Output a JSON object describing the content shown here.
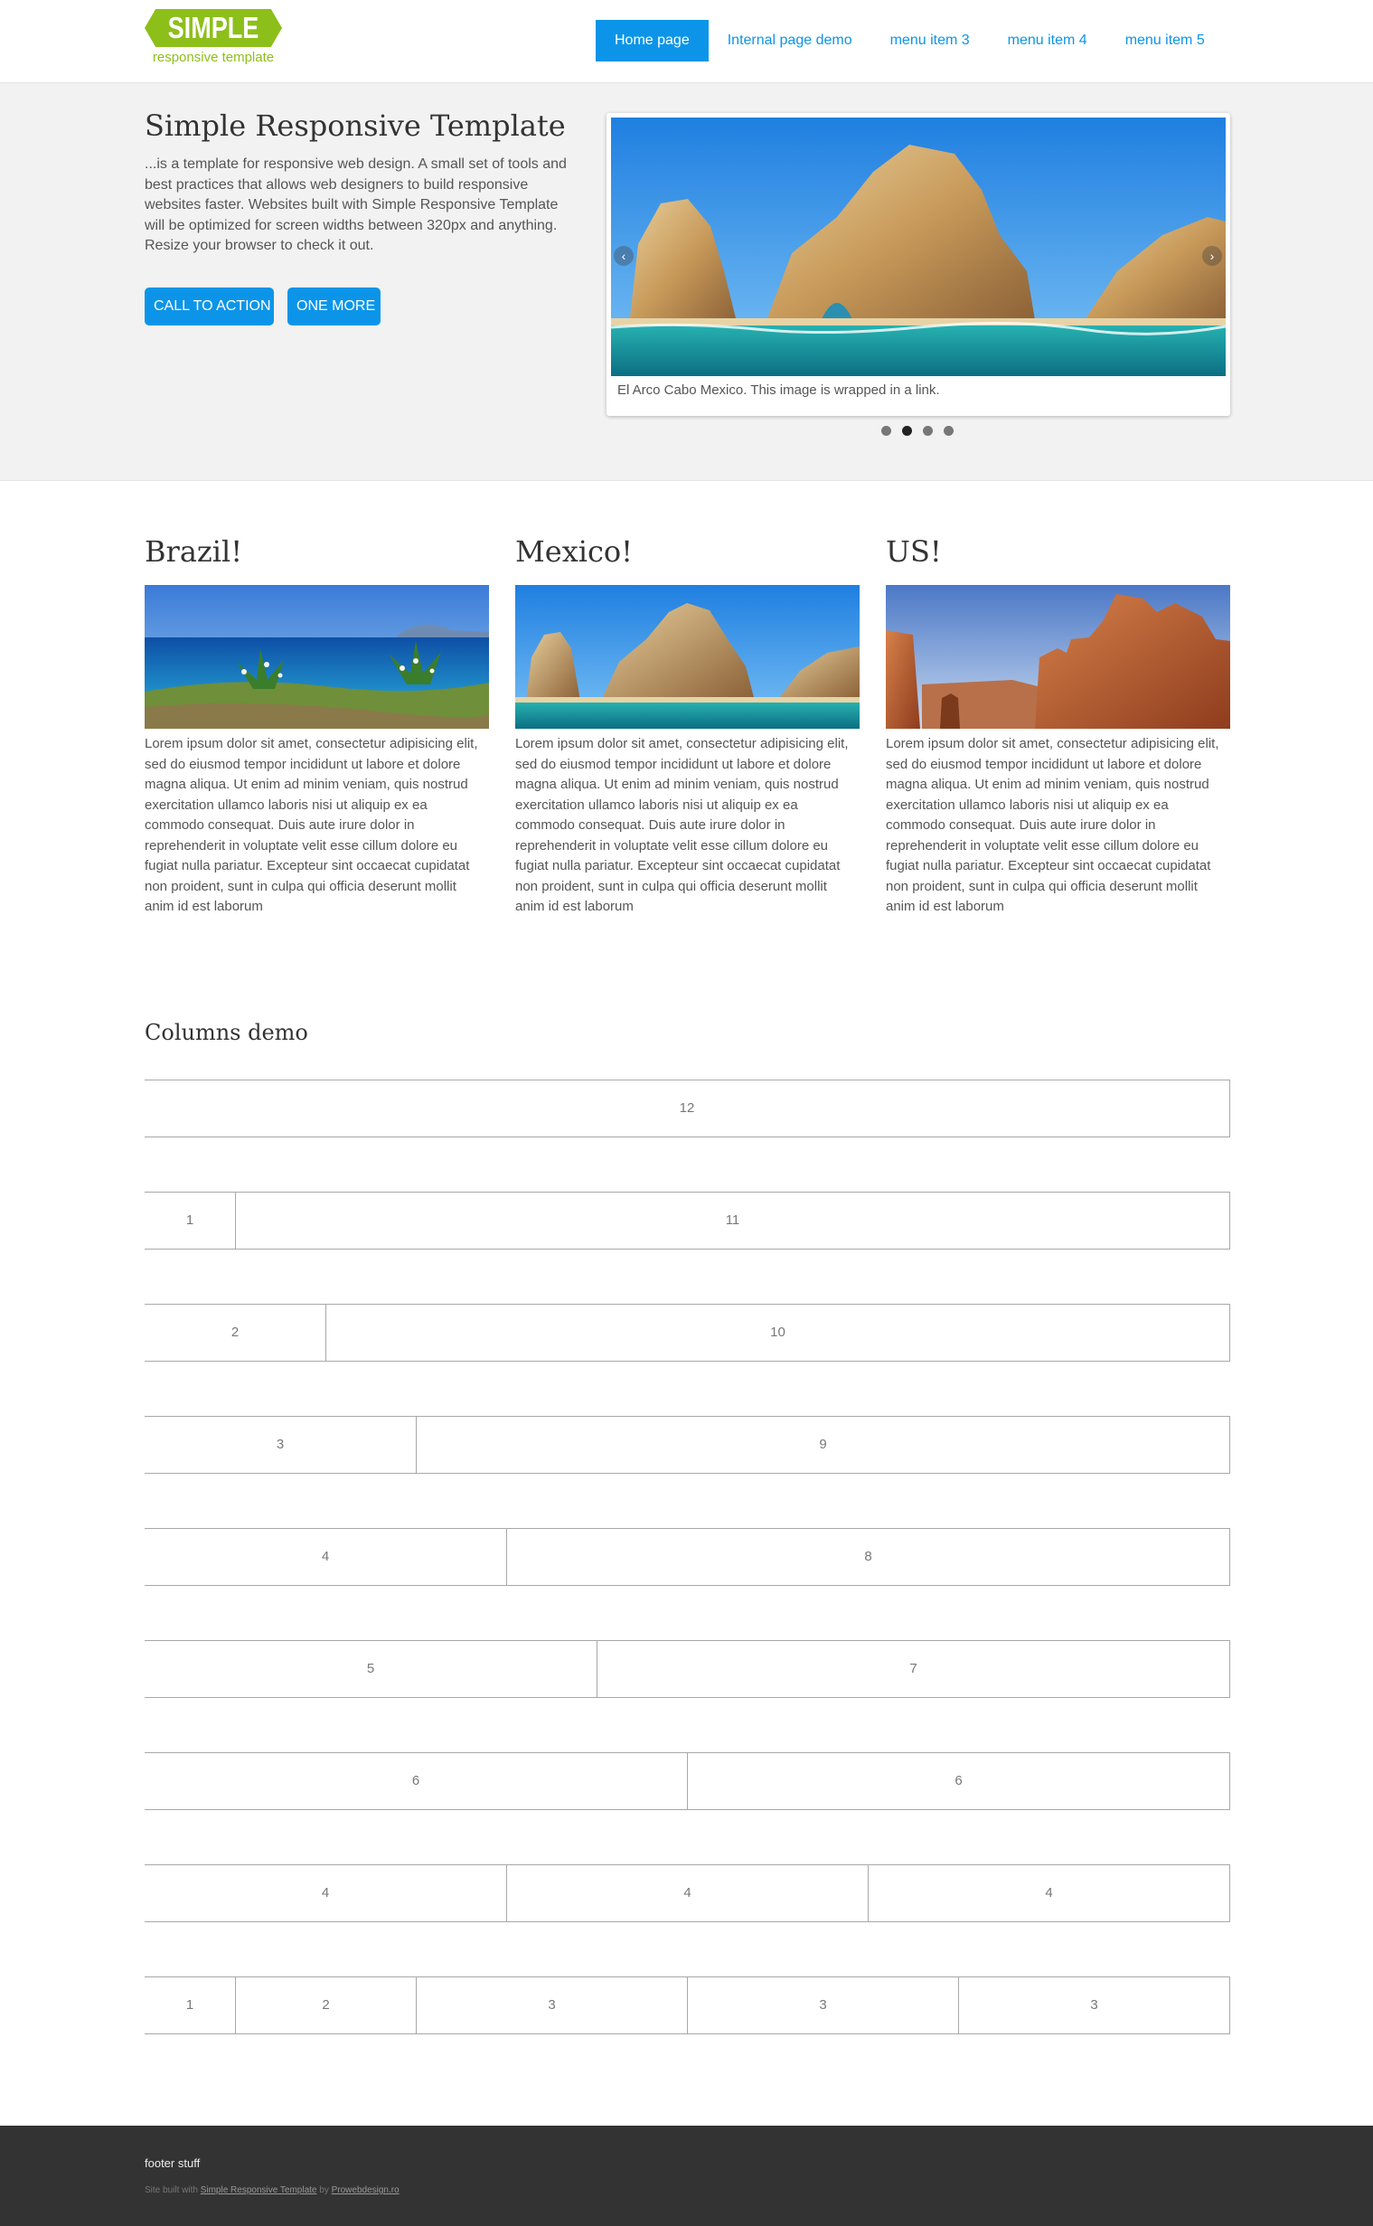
{
  "header": {
    "logo": {
      "word": "SIMPLE",
      "tagline": "responsive template",
      "color": "#8dbf1a"
    },
    "nav": [
      {
        "label": "Home page",
        "active": true
      },
      {
        "label": "Internal page demo",
        "active": false
      },
      {
        "label": "menu item 3",
        "active": false
      },
      {
        "label": "menu item 4",
        "active": false
      },
      {
        "label": "menu item 5",
        "active": false
      }
    ]
  },
  "hero": {
    "title": "Simple Responsive Template",
    "text": "...is a template for responsive web design. A small set of tools and best practices that allows web designers to build responsive websites faster. Websites built with Simple Responsive Template will be optimized for screen widths between 320px and anything. Resize your browser to check it out.",
    "buttons": [
      "CALL TO ACTION",
      "ONE MORE"
    ],
    "slider": {
      "caption": "El Arco Cabo Mexico. This image is wrapped in a link.",
      "prev_icon": "chevron-left-icon",
      "next_icon": "chevron-right-icon",
      "dots": 4,
      "active_dot": 2
    }
  },
  "features": [
    {
      "title": "Brazil!",
      "text": "Lorem ipsum dolor sit amet, consectetur adipisicing elit, sed do eiusmod tempor incididunt ut labore et dolore magna aliqua. Ut enim ad minim veniam, quis nostrud exercitation ullamco laboris nisi ut aliquip ex ea commodo consequat. Duis aute irure dolor in reprehenderit in voluptate velit esse cillum dolore eu fugiat nulla pariatur. Excepteur sint occaecat cupidatat non proident, sunt in culpa qui officia deserunt mollit anim id est laborum"
    },
    {
      "title": "Mexico!",
      "text": "Lorem ipsum dolor sit amet, consectetur adipisicing elit, sed do eiusmod tempor incididunt ut labore et dolore magna aliqua. Ut enim ad minim veniam, quis nostrud exercitation ullamco laboris nisi ut aliquip ex ea commodo consequat. Duis aute irure dolor in reprehenderit in voluptate velit esse cillum dolore eu fugiat nulla pariatur. Excepteur sint occaecat cupidatat non proident, sunt in culpa qui officia deserunt mollit anim id est laborum"
    },
    {
      "title": "US!",
      "text": "Lorem ipsum dolor sit amet, consectetur adipisicing elit, sed do eiusmod tempor incididunt ut labore et dolore magna aliqua. Ut enim ad minim veniam, quis nostrud exercitation ullamco laboris nisi ut aliquip ex ea commodo consequat. Duis aute irure dolor in reprehenderit in voluptate velit esse cillum dolore eu fugiat nulla pariatur. Excepteur sint occaecat cupidatat non proident, sunt in culpa qui officia deserunt mollit anim id est laborum"
    }
  ],
  "columns_demo": {
    "title": "Columns demo",
    "rows": [
      [
        "12"
      ],
      [
        "1",
        "11"
      ],
      [
        "2",
        "10"
      ],
      [
        "3",
        "9"
      ],
      [
        "4",
        "8"
      ],
      [
        "5",
        "7"
      ],
      [
        "6",
        "6"
      ],
      [
        "4",
        "4",
        "4"
      ],
      [
        "1",
        "2",
        "3",
        "3",
        "3"
      ]
    ]
  },
  "footer": {
    "title": "footer stuff",
    "credit_prefix": "Site built with",
    "credit_link": "Simple Responsive Template",
    "credit_by": "by",
    "credit_author": "Prowebdesign.ro"
  },
  "colors": {
    "accent": "#0c95e8",
    "hero_bg": "#f2f2f2",
    "footer_bg": "#333333"
  }
}
